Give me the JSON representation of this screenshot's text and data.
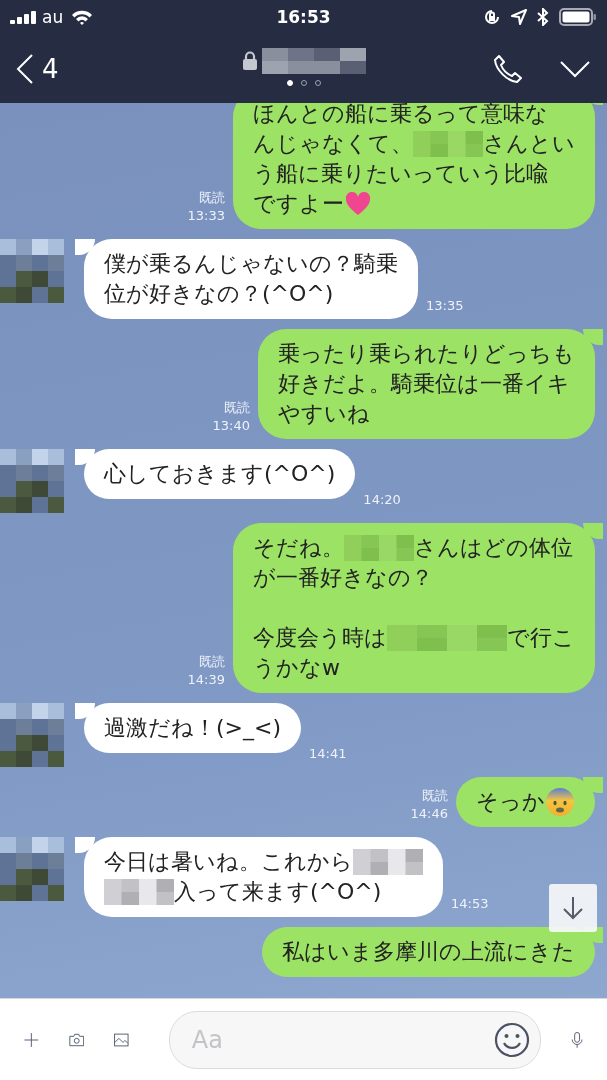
{
  "status_bar": {
    "carrier": "au",
    "time": "16:53"
  },
  "header": {
    "back_count": "4",
    "pages": [
      {
        "selected": true
      },
      {
        "selected": false
      },
      {
        "selected": false
      }
    ]
  },
  "messages": [
    {
      "kind": "outgoing",
      "read": "既読",
      "time": "13:33",
      "segments": [
        {
          "kind": "text",
          "text": "ほんとの船に乗るって意味な"
        },
        {
          "kind": "break"
        },
        {
          "kind": "text",
          "text": "んじゃなくて、"
        },
        {
          "kind": "mosaic"
        },
        {
          "kind": "text",
          "text": "さんとい"
        },
        {
          "kind": "break"
        },
        {
          "kind": "text",
          "text": "う船に乗りたいっていう比喩"
        },
        {
          "kind": "break"
        },
        {
          "kind": "text",
          "text": "ですよー"
        },
        {
          "kind": "heart"
        }
      ]
    },
    {
      "kind": "incoming",
      "time": "13:35",
      "segments": [
        {
          "kind": "text",
          "text": "僕が乗るんじゃないの？騎乗"
        },
        {
          "kind": "break"
        },
        {
          "kind": "text",
          "text": "位が好きなの？(^O^)"
        }
      ]
    },
    {
      "kind": "outgoing",
      "read": "既読",
      "time": "13:40",
      "segments": [
        {
          "kind": "text",
          "text": "乗ったり乗られたりどっちも"
        },
        {
          "kind": "break"
        },
        {
          "kind": "text",
          "text": "好きだよ。騎乗位は一番イキ"
        },
        {
          "kind": "break"
        },
        {
          "kind": "text",
          "text": "やすいね"
        }
      ]
    },
    {
      "kind": "incoming",
      "time": "14:20",
      "segments": [
        {
          "kind": "text",
          "text": "心しておきます(^O^)"
        }
      ]
    },
    {
      "kind": "outgoing",
      "read": "既読",
      "time": "14:39",
      "segments": [
        {
          "kind": "text",
          "text": "そだね。"
        },
        {
          "kind": "mosaic"
        },
        {
          "kind": "text",
          "text": "さんはどの体位"
        },
        {
          "kind": "break"
        },
        {
          "kind": "text",
          "text": "が一番好きなの？"
        },
        {
          "kind": "break"
        },
        {
          "kind": "break"
        },
        {
          "kind": "text",
          "text": "今度会う時は"
        },
        {
          "kind": "widemosaic"
        },
        {
          "kind": "text",
          "text": "で行こ"
        },
        {
          "kind": "break"
        },
        {
          "kind": "text",
          "text": "うかなw"
        }
      ]
    },
    {
      "kind": "incoming",
      "time": "14:41",
      "segments": [
        {
          "kind": "text",
          "text": "過激だね！(>_<)"
        }
      ]
    },
    {
      "kind": "outgoing",
      "read": "既読",
      "time": "14:46",
      "segments": [
        {
          "kind": "text",
          "text": "そっか"
        },
        {
          "kind": "face"
        }
      ]
    },
    {
      "kind": "incoming",
      "time": "14:53",
      "segments": [
        {
          "kind": "text",
          "text": "今日は暑いね。これから"
        },
        {
          "kind": "mosaic"
        },
        {
          "kind": "break"
        },
        {
          "kind": "mosaic"
        },
        {
          "kind": "text",
          "text": "入って来ます(^O^)"
        }
      ]
    },
    {
      "kind": "outgoing",
      "segments": [
        {
          "kind": "text",
          "text": "私はいま多摩川の上流にきた"
        }
      ]
    }
  ],
  "composer": {
    "placeholder": "Aa"
  }
}
